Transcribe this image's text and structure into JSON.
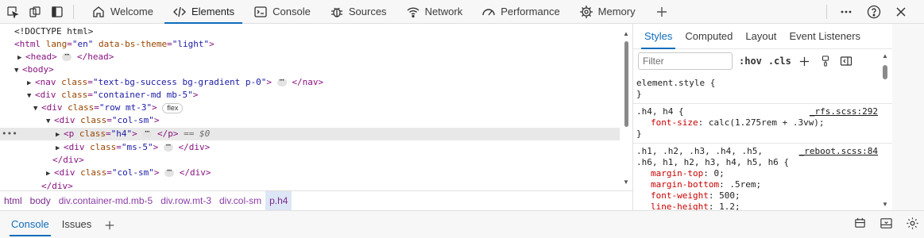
{
  "toolbar": {
    "tabs": [
      {
        "label": "Welcome",
        "icon": "home-icon"
      },
      {
        "label": "Elements",
        "icon": "code-icon"
      },
      {
        "label": "Console",
        "icon": "console-icon"
      },
      {
        "label": "Sources",
        "icon": "bug-icon"
      },
      {
        "label": "Network",
        "icon": "wifi-icon"
      },
      {
        "label": "Performance",
        "icon": "gauge-icon"
      },
      {
        "label": "Memory",
        "icon": "chip-icon"
      }
    ],
    "active_tab": "Elements"
  },
  "dom": {
    "doctype": "<!DOCTYPE html>",
    "html_open": {
      "tag": "<html",
      "attr": "lang",
      "val": "\"en\"",
      "attr2": "data-bs-theme",
      "val2": "\"light\"",
      "close": ">"
    },
    "head": {
      "open": "<head>",
      "close": "</head>"
    },
    "body_open": "<body>",
    "nav": {
      "tag": "<nav",
      "attr": "class",
      "val": "\"text-bg-success bg-gradient p-0\"",
      "close": ">",
      "end": "</nav>"
    },
    "div_container": {
      "tag": "<div",
      "attr": "class",
      "val": "\"container-md mb-5\"",
      "close": ">"
    },
    "div_row": {
      "tag": "<div",
      "attr": "class",
      "val": "\"row mt-3\"",
      "close": ">",
      "badge": "flex"
    },
    "div_col": {
      "tag": "<div",
      "attr": "class",
      "val": "\"col-sm\"",
      "close": ">"
    },
    "p_h4": {
      "tag": "<p",
      "attr": "class",
      "val": "\"h4\"",
      "close": ">",
      "end": "</p>",
      "marker": "== $0"
    },
    "div_ms5": {
      "tag": "<div",
      "attr": "class",
      "val": "\"ms-5\"",
      "close": ">",
      "end": "</div>"
    },
    "div_close": "</div>",
    "div_col2": {
      "tag": "<div",
      "attr": "class",
      "val": "\"col-sm\"",
      "close": ">",
      "end": "</div>"
    },
    "div_close2": "</div>"
  },
  "breadcrumbs": [
    "html",
    "body",
    "div.container-md.mb-5",
    "div.row.mt-3",
    "div.col-sm",
    "p.h4"
  ],
  "styles": {
    "tabs": [
      "Styles",
      "Computed",
      "Layout",
      "Event Listeners"
    ],
    "filter_placeholder": "Filter",
    "hov": ":hov",
    "cls": ".cls",
    "rules": {
      "element_style": {
        "selector": "element.style {",
        "close": "}"
      },
      "h4": {
        "selector": ".h4, h4 {",
        "source": "_rfs.scss:292",
        "prop": "font-size",
        "value": "calc(1.275rem + .3vw);",
        "close": "}"
      },
      "headings": {
        "selector_line1": ".h1, .h2, .h3, .h4, .h5,",
        "selector_line2": ".h6, h1, h2, h3, h4, h5, h6 {",
        "source": "_reboot.scss:84",
        "props": [
          {
            "prop": "margin-top",
            "value": "0;"
          },
          {
            "prop": "margin-bottom",
            "value": ".5rem;"
          },
          {
            "prop": "font-weight",
            "value": "500;"
          },
          {
            "prop": "line-height",
            "value": "1.2;"
          }
        ]
      }
    }
  },
  "drawer": {
    "tabs": [
      "Console",
      "Issues"
    ],
    "active_tab": "Console"
  },
  "colors": {
    "accent": "#0f6cbd",
    "tag": "#881280",
    "attr": "#994500",
    "value": "#1a1aa6",
    "property": "#c80000"
  }
}
